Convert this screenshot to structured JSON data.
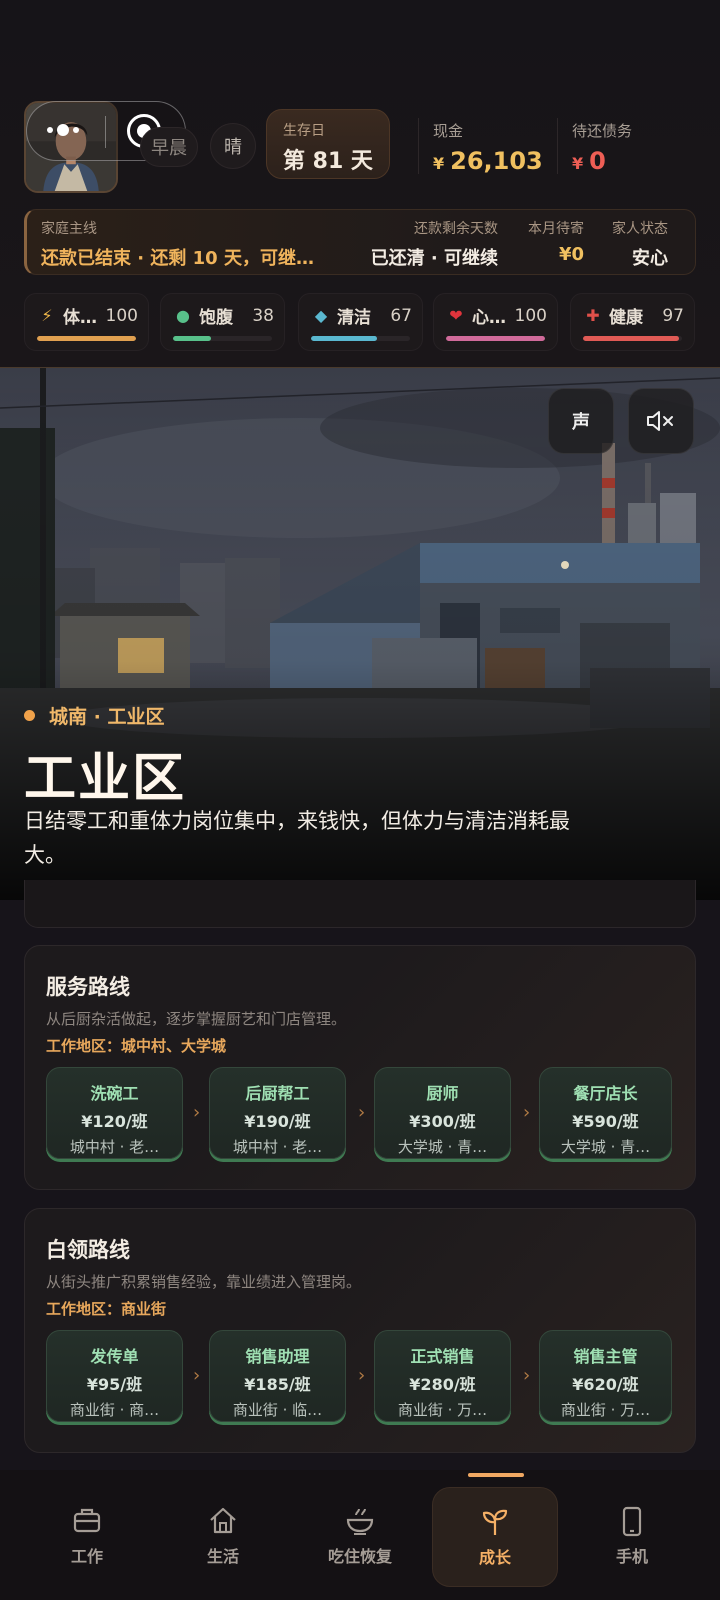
{
  "header": {
    "time_of_day": "早晨",
    "weather": "晴",
    "day_label": "生存日",
    "day_value": "第 81 天",
    "cash_label": "现金",
    "cash_currency": "¥",
    "cash_value": "26,103",
    "debt_label": "待还债务",
    "debt_currency": "¥",
    "debt_value": "0"
  },
  "family": {
    "main_label": "家庭主线",
    "main_value": "还款已结束 · 还剩 10 天，可继…",
    "repay_label": "还款剩余天数",
    "repay_value": "已还清 · 可继续",
    "remit_label": "本月待寄",
    "remit_value": "¥0",
    "status_label": "家人状态",
    "status_value": "安心"
  },
  "meters": [
    {
      "name": "体…",
      "value": "100",
      "level": 1.0,
      "icon": "lightning-icon",
      "color": "#e0a050"
    },
    {
      "name": "饱腹",
      "value": "38",
      "level": 0.38,
      "icon": "dot-icon",
      "color": "#58c08a"
    },
    {
      "name": "清洁",
      "value": "67",
      "level": 0.67,
      "icon": "diamond-icon",
      "color": "#5ab8d0"
    },
    {
      "name": "心…",
      "value": "100",
      "level": 1.0,
      "icon": "heart-icon",
      "color": "#d06a9a"
    },
    {
      "name": "健康",
      "value": "97",
      "level": 0.97,
      "icon": "cross-icon",
      "color": "#e05a55"
    }
  ],
  "hero": {
    "sound_label": "声",
    "location": "城南 · 工业区",
    "title": "工业区",
    "description": "日结零工和重体力岗位集中，来钱快，但体力与清洁消耗最大。"
  },
  "routes": [
    {
      "title": "服务路线",
      "description": "从后厨杂活做起，逐步掌握厨艺和门店管理。",
      "area": "工作地区：城中村、大学城",
      "jobs": [
        {
          "name": "洗碗工",
          "pay": "¥120/班",
          "location": "城中村 · 老…"
        },
        {
          "name": "后厨帮工",
          "pay": "¥190/班",
          "location": "城中村 · 老…"
        },
        {
          "name": "厨师",
          "pay": "¥300/班",
          "location": "大学城 · 青…"
        },
        {
          "name": "餐厅店长",
          "pay": "¥590/班",
          "location": "大学城 · 青…"
        }
      ]
    },
    {
      "title": "白领路线",
      "description": "从街头推广积累销售经验，靠业绩进入管理岗。",
      "area": "工作地区：商业街",
      "jobs": [
        {
          "name": "发传单",
          "pay": "¥95/班",
          "location": "商业街 · 商…"
        },
        {
          "name": "销售助理",
          "pay": "¥185/班",
          "location": "商业街 · 临…"
        },
        {
          "name": "正式销售",
          "pay": "¥280/班",
          "location": "商业街 · 万…"
        },
        {
          "name": "销售主管",
          "pay": "¥620/班",
          "location": "商业街 · 万…"
        }
      ]
    }
  ],
  "nav": {
    "tabs": [
      {
        "label": "工作",
        "icon": "briefcase-icon"
      },
      {
        "label": "生活",
        "icon": "home-icon"
      },
      {
        "label": "吃住恢复",
        "icon": "bowl-icon"
      },
      {
        "label": "成长",
        "icon": "sprout-icon",
        "active": true
      },
      {
        "label": "手机",
        "icon": "phone-icon"
      }
    ]
  }
}
